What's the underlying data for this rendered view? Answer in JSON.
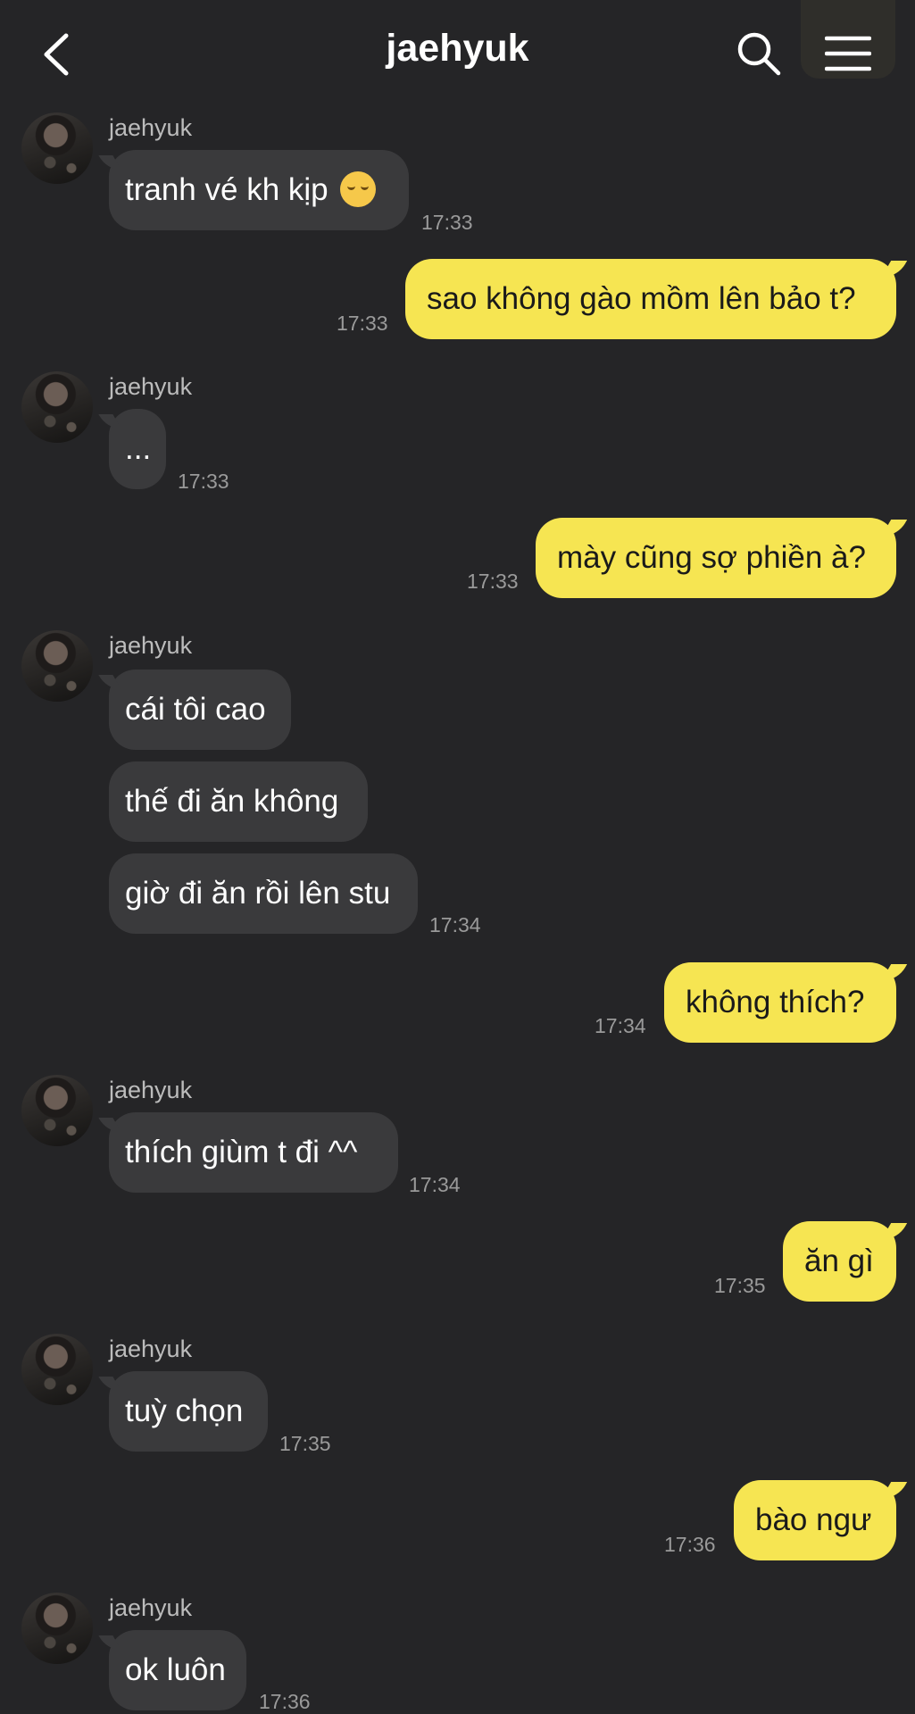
{
  "header": {
    "title": "jaehyuk"
  },
  "messages": [
    {
      "sender": "jaehyuk",
      "text": "tranh vé kh kịp",
      "time": "17:33",
      "emoji": "pensive-face"
    },
    {
      "text": "sao không gào mồm lên bảo t?",
      "time": "17:33"
    },
    {
      "sender": "jaehyuk",
      "text": "...",
      "time": "17:33"
    },
    {
      "text": "mày cũng sợ phiền à?",
      "time": "17:33"
    },
    {
      "sender": "jaehyuk",
      "texts": [
        "cái tôi cao",
        "thế đi ăn không",
        "giờ đi ăn rồi lên stu"
      ],
      "time": "17:34"
    },
    {
      "text": "không thích?",
      "time": "17:34"
    },
    {
      "sender": "jaehyuk",
      "text": "thích giùm t đi ^^",
      "time": "17:34"
    },
    {
      "text": "ăn gì",
      "time": "17:35"
    },
    {
      "sender": "jaehyuk",
      "text": "tuỳ chọn",
      "time": "17:35"
    },
    {
      "text": "bào ngư",
      "time": "17:36"
    },
    {
      "sender": "jaehyuk",
      "text": "ok luôn",
      "time": "17:36"
    }
  ],
  "icons": [
    "back-chevron-icon",
    "search-icon",
    "menu-icon"
  ],
  "colors": {
    "background": "#252527",
    "incoming_bubble": "#3a3a3c",
    "outgoing_bubble": "#f6e552"
  }
}
